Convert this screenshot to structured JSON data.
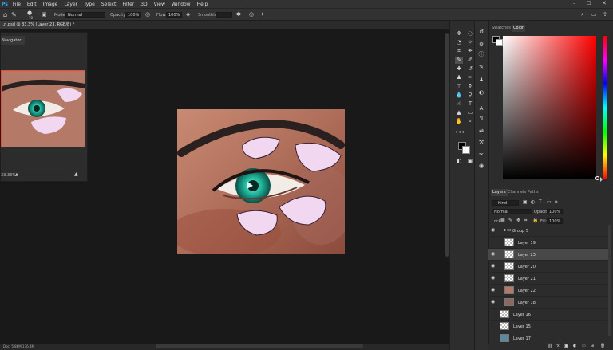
{
  "menu": [
    "File",
    "Edit",
    "Image",
    "Layer",
    "Type",
    "Select",
    "Filter",
    "3D",
    "View",
    "Window",
    "Help"
  ],
  "options": {
    "brush_size": "70",
    "mode_label": "Mode:",
    "mode_value": "Normal",
    "opacity_label": "Opacity:",
    "opacity_value": "100%",
    "flow_label": "Flow:",
    "flow_value": "100%",
    "smoothing_label": "Smoothing:"
  },
  "document_tab": "..n.psd @ 33.3% (Layer 23, RGB/8) *",
  "navigator": {
    "title": "Navigator",
    "zoom": "33.33%"
  },
  "color_panel": {
    "tab_swatches": "Swatches",
    "tab_color": "Color",
    "foreground": "#000000",
    "background": "#ffffff"
  },
  "layers_panel": {
    "tabs": [
      "Layers",
      "Channels",
      "Paths"
    ],
    "filter_label": "Kind",
    "blend_mode": "Normal",
    "opacity_label": "Opacity:",
    "opacity_value": "100%",
    "lock_label": "Lock:",
    "fill_label": "Fill:",
    "fill_value": "100%",
    "group": "Group 5",
    "layers": [
      {
        "name": "Layer 19",
        "visible": false,
        "selected": false
      },
      {
        "name": "Layer 23",
        "visible": true,
        "selected": true
      },
      {
        "name": "Layer 20",
        "visible": true,
        "selected": false
      },
      {
        "name": "Layer 21",
        "visible": true,
        "selected": false
      },
      {
        "name": "Layer 22",
        "visible": true,
        "selected": false
      },
      {
        "name": "Layer 18",
        "visible": true,
        "selected": false
      },
      {
        "name": "Layer 16",
        "visible": false,
        "selected": false
      },
      {
        "name": "Layer 15",
        "visible": false,
        "selected": false
      },
      {
        "name": "Layer 17",
        "visible": false,
        "selected": false
      }
    ]
  },
  "status": "Doc: 5.86M/176.4M",
  "colors": {
    "chrome": "#323232",
    "canvas_bg": "#191919",
    "selection": "#484848"
  }
}
